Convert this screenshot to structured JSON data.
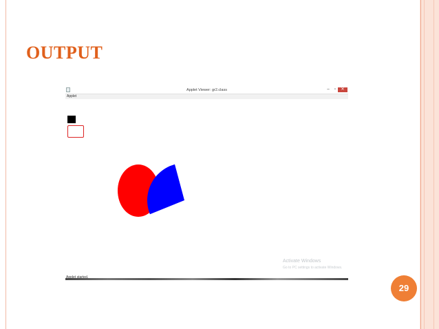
{
  "slide": {
    "title": "OUTPUT",
    "page_number": "29",
    "accent_color": "#e0601c",
    "badge_color": "#ef7f35"
  },
  "window": {
    "title": "Applet Viewer: gr2.class",
    "menu": [
      "Applet"
    ],
    "controls": {
      "minimize_icon": "minimize-icon",
      "minimize_glyph": "–",
      "maximize_icon": "maximize-icon",
      "maximize_glyph": "▫",
      "close_icon": "close-icon",
      "close_glyph": "✕"
    },
    "status": "Applet started."
  },
  "canvas": {
    "filled_square_color": "#000000",
    "outlined_rect_color": "#dd2222",
    "filled_oval_color": "#ff0000",
    "filled_arc_color": "#0000ff"
  },
  "watermark": {
    "title": "Activate Windows",
    "subtitle": "Go to PC settings to activate Windows."
  }
}
